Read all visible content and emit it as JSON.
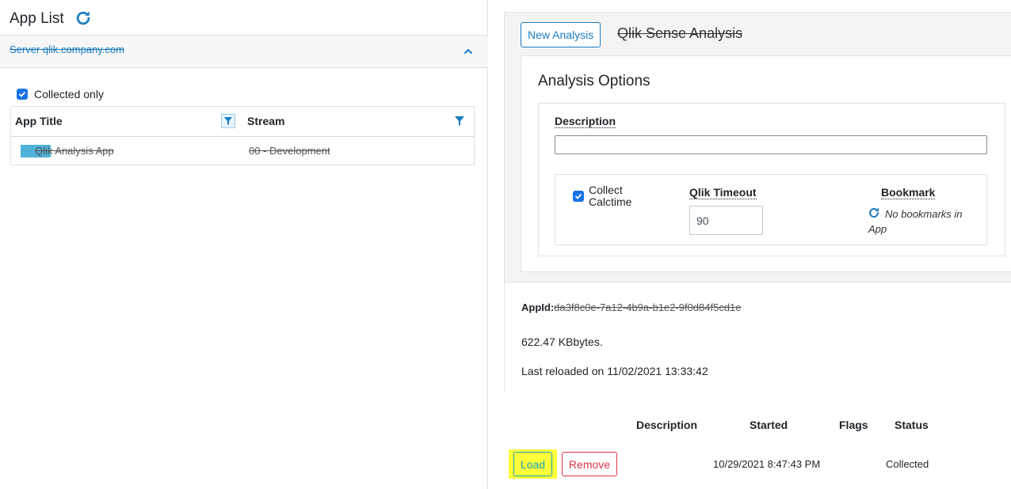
{
  "left_panel": {
    "title": "App List",
    "server_link": "Server qlik.company.com",
    "collected_only_label": "Collected only",
    "table": {
      "headers": {
        "app_title": "App Title",
        "stream": "Stream"
      },
      "rows": [
        {
          "title": "Qlik Analysis App",
          "stream": "00 - Development"
        }
      ]
    }
  },
  "right_panel": {
    "new_analysis_label": "New Analysis",
    "analysis_name": "Qlik Sense Analysis",
    "options": {
      "title": "Analysis Options",
      "description_label": "Description",
      "description_value": "",
      "collect_calctime_label": "Collect Calctime",
      "qlik_timeout_label": "Qlik Timeout",
      "qlik_timeout_value": "90",
      "bookmark_label": "Bookmark",
      "no_bookmarks_text": "No bookmarks in App"
    },
    "info": {
      "appid_label": "AppId:",
      "appid_value": "da3f8c0e-7a12-4b9a-b1e2-9f0d84f5cd1e",
      "size_text": "622.47 KBbytes.",
      "reload_text": "Last reloaded on 11/02/2021 13:33:42"
    }
  },
  "history": {
    "headers": {
      "description": "Description",
      "started": "Started",
      "flags": "Flags",
      "status": "Status"
    },
    "rows": [
      {
        "load_label": "Load",
        "remove_label": "Remove",
        "description": "",
        "started": "10/29/2021 8:47:43 PM",
        "flags": "",
        "status": "Collected"
      }
    ]
  },
  "colors": {
    "accent": "#1a7bc0",
    "checkbox": "#1a73e8",
    "highlight": "#ffff3a",
    "danger": "#dc3545",
    "info": "#17a2b8"
  }
}
